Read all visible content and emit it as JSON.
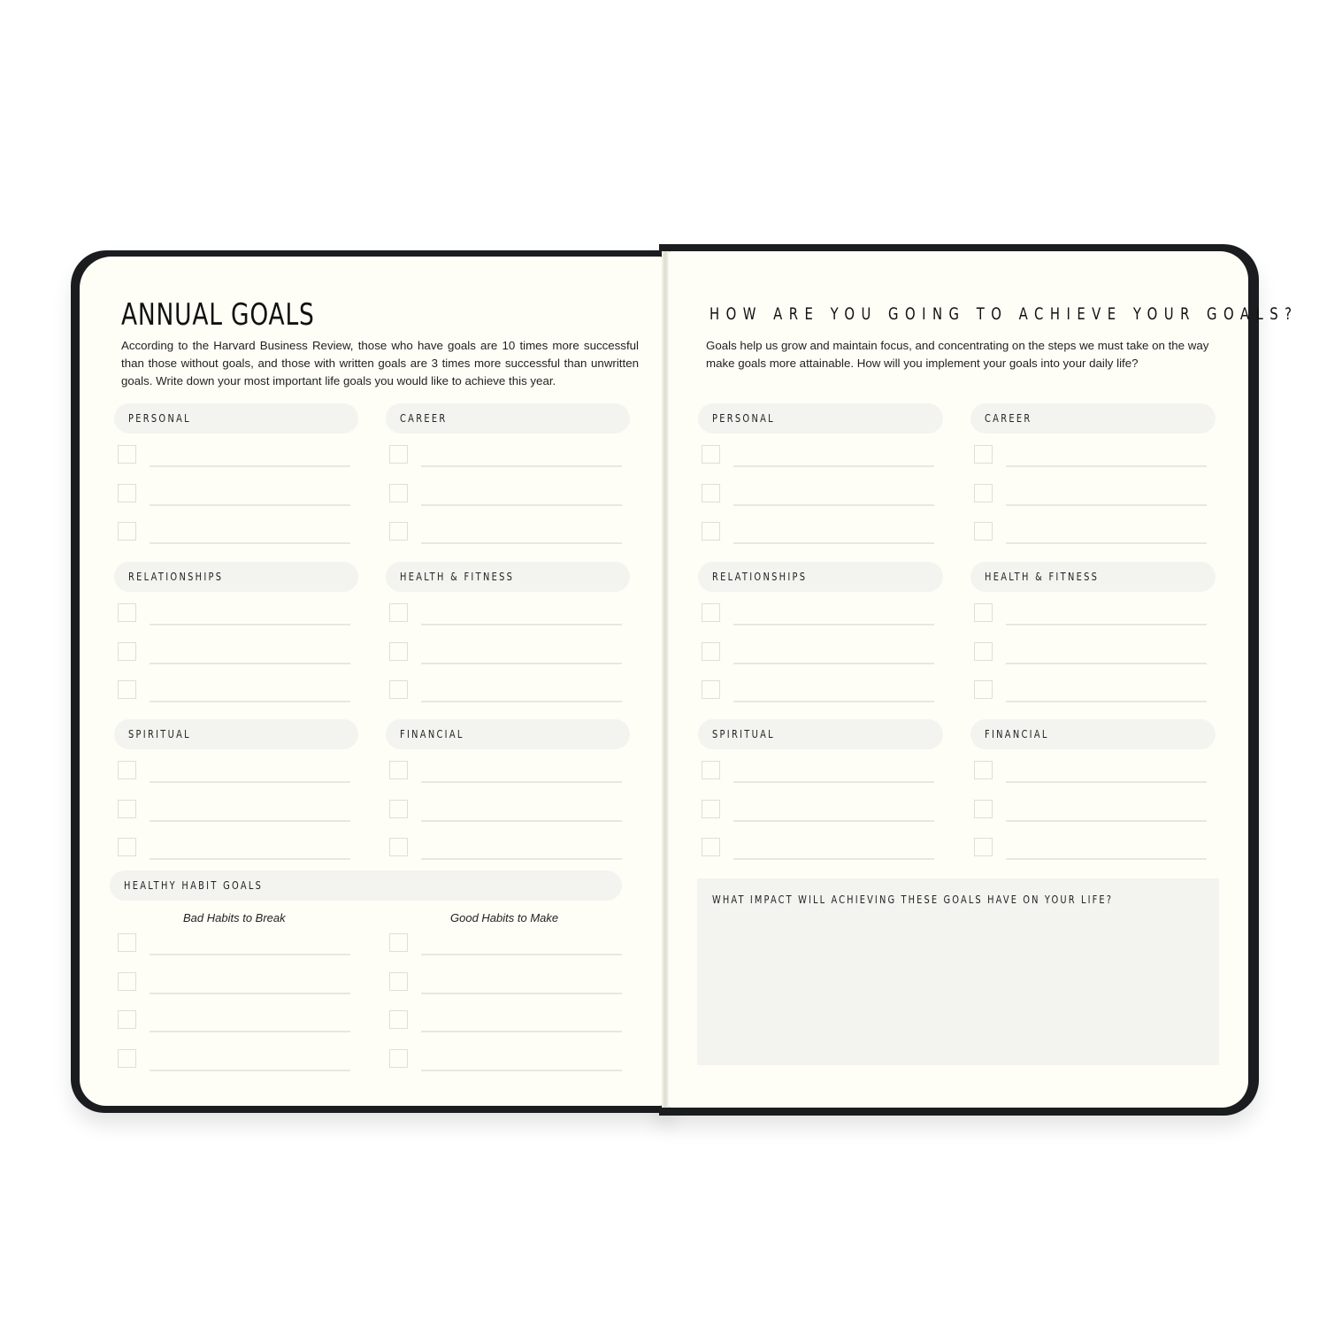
{
  "left_page": {
    "title": "ANNUAL GOALS",
    "intro": "According to the Harvard Business Review, those who have goals are 10 times more successful than those without goals, and those with written goals are 3 times more successful than unwritten goals.  Write down your most important life goals you would like to achieve this year.",
    "sections": [
      {
        "label": "PERSONAL",
        "rows": 3
      },
      {
        "label": "CAREER",
        "rows": 3
      },
      {
        "label": "RELATIONSHIPS",
        "rows": 3
      },
      {
        "label": "HEALTH & FITNESS",
        "rows": 3
      },
      {
        "label": "SPIRITUAL",
        "rows": 3
      },
      {
        "label": "FINANCIAL",
        "rows": 3
      }
    ],
    "habits": {
      "label": "HEALTHY HABIT GOALS",
      "bad_label": "Bad Habits to Break",
      "good_label": "Good Habits to Make",
      "rows": 4
    }
  },
  "right_page": {
    "title": "HOW ARE YOU GOING TO ACHIEVE YOUR GOALS?",
    "intro": "Goals help us grow and maintain focus, and concentrating on the steps we must take on the way make goals more attainable. How will you implement your goals into your daily life?",
    "sections": [
      {
        "label": "PERSONAL",
        "rows": 3
      },
      {
        "label": "CAREER",
        "rows": 3
      },
      {
        "label": "RELATIONSHIPS",
        "rows": 3
      },
      {
        "label": "HEALTH & FITNESS",
        "rows": 3
      },
      {
        "label": "SPIRITUAL",
        "rows": 3
      },
      {
        "label": "FINANCIAL",
        "rows": 3
      }
    ],
    "impact_label": "WHAT IMPACT WILL ACHIEVING THESE GOALS HAVE ON YOUR LIFE?"
  },
  "colors": {
    "cover": "#1b1c1f",
    "paper": "#fefef7",
    "pill": "#f3f4ef",
    "checkbox_border": "#dcdfdc",
    "rule_line": "#e6e8e4"
  }
}
